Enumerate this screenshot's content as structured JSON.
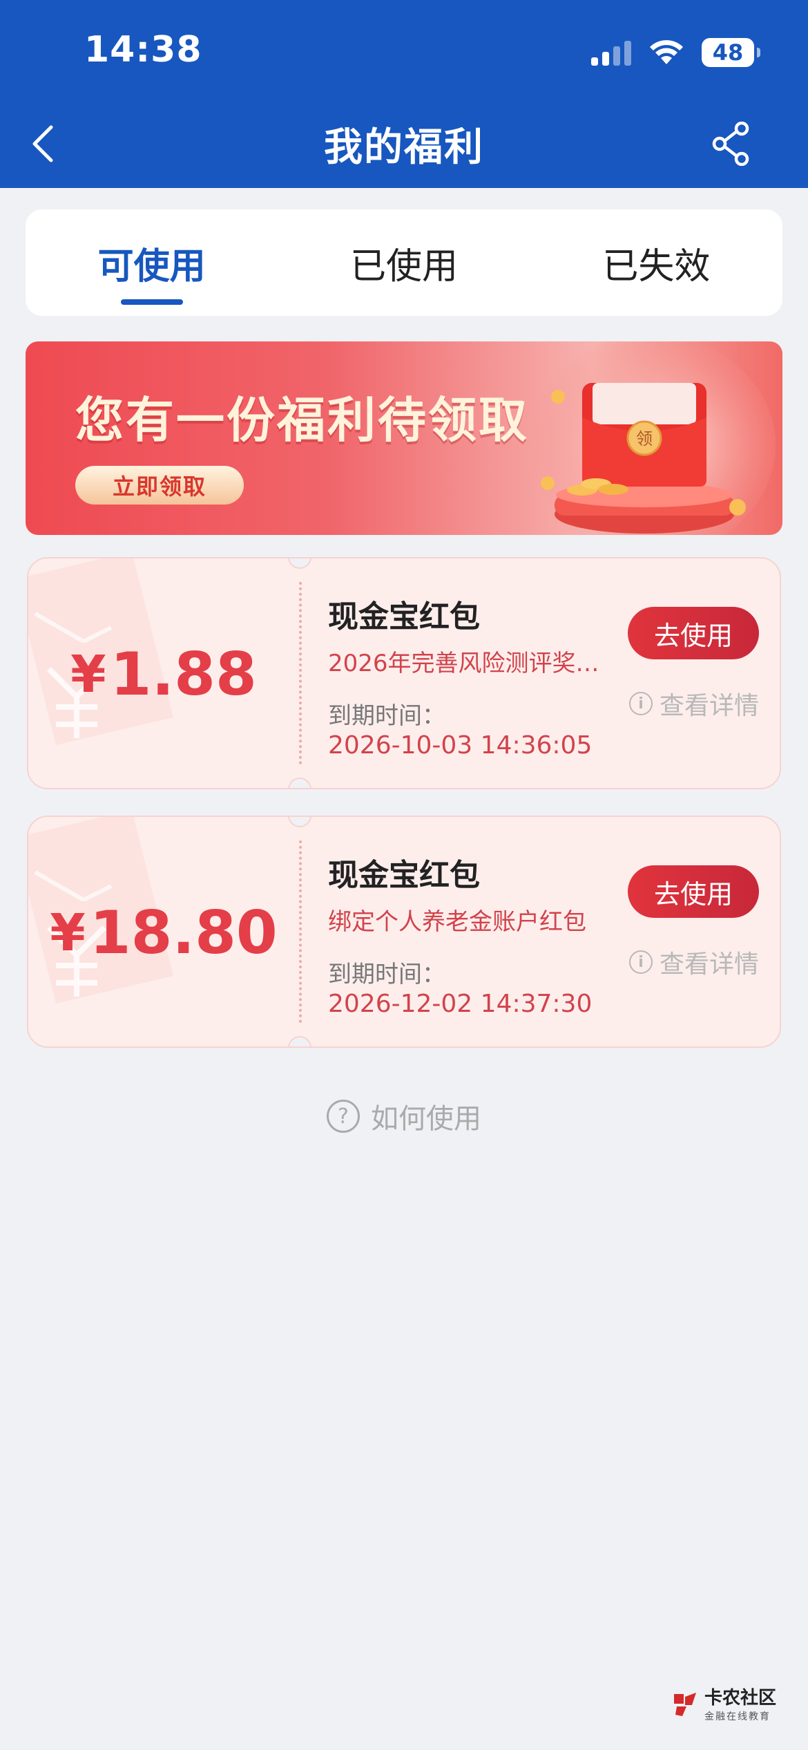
{
  "status_bar": {
    "time": "14:38",
    "battery": "48"
  },
  "header": {
    "title": "我的福利"
  },
  "tabs": [
    {
      "label": "可使用",
      "active": true
    },
    {
      "label": "已使用",
      "active": false
    },
    {
      "label": "已失效",
      "active": false
    }
  ],
  "banner": {
    "title": "您有一份福利待领取",
    "button": "立即领取",
    "envelope_text": "领"
  },
  "coupons": [
    {
      "currency": "¥",
      "amount": "1.88",
      "title": "现金宝红包",
      "desc": "2026年完善风险测评奖…",
      "expiry_label": "到期时间：",
      "expiry": "2026-10-03 14:36:05",
      "use_button": "去使用",
      "detail_link": "查看详情"
    },
    {
      "currency": "¥",
      "amount": "18.80",
      "title": "现金宝红包",
      "desc": "绑定个人养老金账户红包",
      "expiry_label": "到期时间：",
      "expiry": "2026-12-02 14:37:30",
      "use_button": "去使用",
      "detail_link": "查看详情"
    }
  ],
  "howto": {
    "label": "如何使用"
  },
  "watermark": {
    "main": "卡农社区",
    "sub": "金融在线教育"
  },
  "colors": {
    "brand": "#1757bf",
    "coupon_red": "#e43e48",
    "background": "#f0f1f5"
  }
}
